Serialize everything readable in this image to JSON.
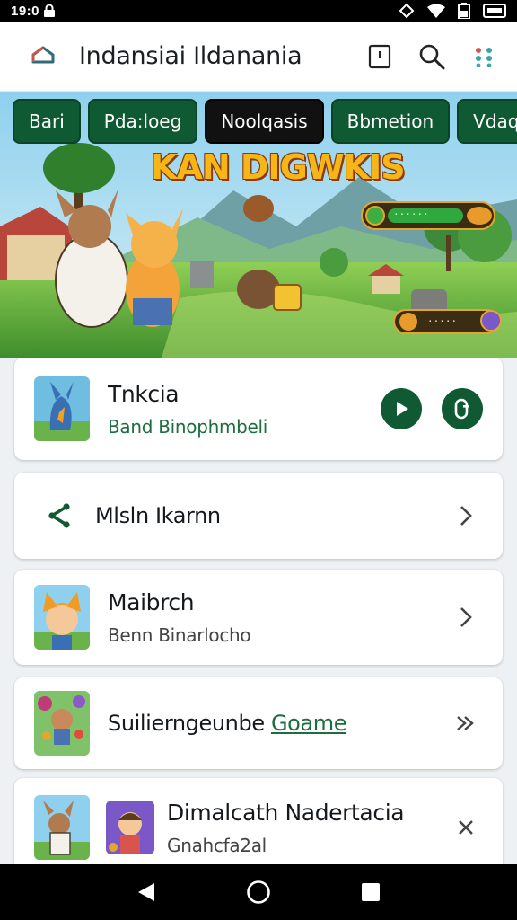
{
  "status": {
    "time": "19:0"
  },
  "app": {
    "title": "Indansiai Ildanania"
  },
  "tabs": [
    {
      "label": "Bari",
      "active": false
    },
    {
      "label": "Pda:loeg",
      "active": false
    },
    {
      "label": "Noolqasis",
      "active": true
    },
    {
      "label": "Bbmetion",
      "active": false
    },
    {
      "label": "Vdaqecin",
      "active": false
    }
  ],
  "banner": {
    "title": "KAN DIGWKIS",
    "hud_label": "······",
    "hud2_label": "·····"
  },
  "cards": {
    "c1": {
      "name": "Tnkcia",
      "sub": "Band Binophmbeli"
    },
    "c2": {
      "name": "Mlsln Ikarnn"
    },
    "c3": {
      "name": "Maibrch",
      "sub": "Benn Binarlocho"
    },
    "c4": {
      "name_a": "Suilierngeunbe ",
      "name_b": "Goame"
    },
    "c5": {
      "name": "Dimalcath Nadertacia",
      "sub": "Gnahcfa2al"
    }
  },
  "colors": {
    "accent": "#0f5a33",
    "banner_title": "#f6b617"
  },
  "icons": [
    "lock-icon",
    "home-icon",
    "info-icon",
    "search-icon",
    "apps-icon",
    "play-icon",
    "toggle-icon",
    "share-icon",
    "chevron-right-icon",
    "double-chevron-icon",
    "back-icon",
    "home-nav-icon",
    "recents-icon"
  ]
}
